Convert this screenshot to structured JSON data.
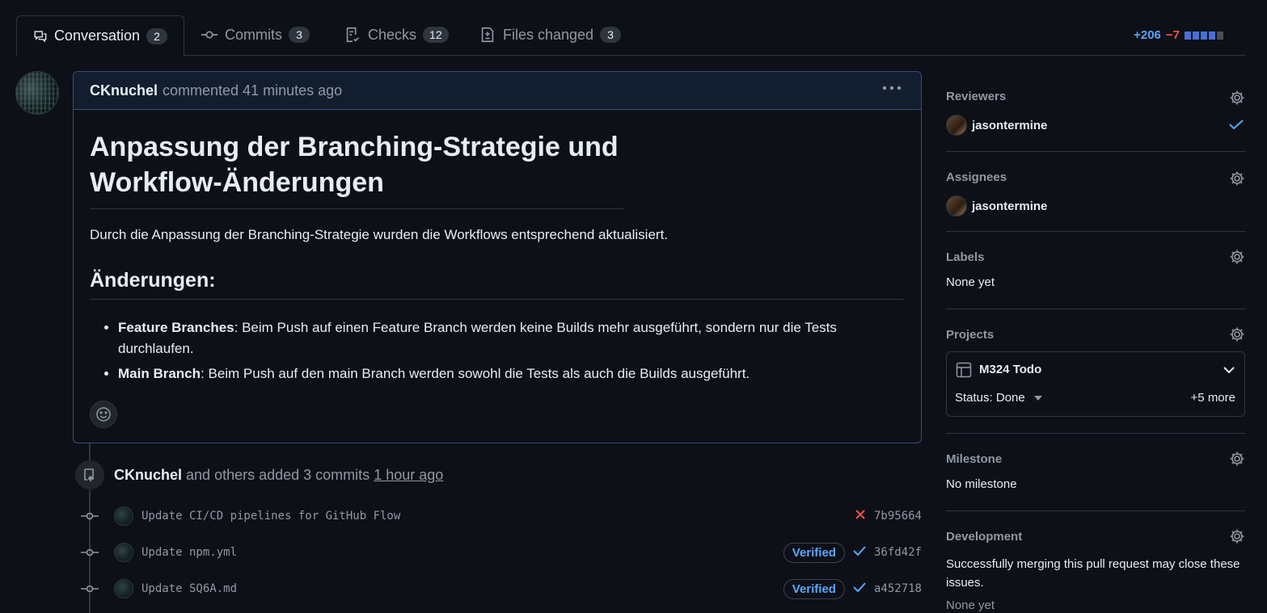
{
  "tabs": [
    {
      "label": "Conversation",
      "count": "2",
      "icon": "comment-discussion-icon",
      "active": true
    },
    {
      "label": "Commits",
      "count": "3",
      "icon": "git-commit-icon",
      "active": false
    },
    {
      "label": "Checks",
      "count": "12",
      "icon": "checklist-icon",
      "active": false
    },
    {
      "label": "Files changed",
      "count": "3",
      "icon": "file-diff-icon",
      "active": false
    }
  ],
  "diffstat": {
    "additions": "+206",
    "deletions": "−7",
    "blocks_filled_fraction": 0.8
  },
  "comment": {
    "author": "CKnuchel",
    "meta": "commented 41 minutes ago",
    "title": "Anpassung der Branching-Strategie und Workflow-Änderungen",
    "intro": "Durch die Anpassung der Branching-Strategie wurden die Workflows entsprechend aktualisiert.",
    "changes_heading": "Änderungen:",
    "items": [
      {
        "strong": "Feature Branches",
        "text": ": Beim Push auf einen Feature Branch werden keine Builds mehr ausgeführt, sondern nur die Tests durchlaufen."
      },
      {
        "strong": "Main Branch",
        "text": ": Beim Push auf den main Branch werden sowohl die Tests als auch die Builds ausgeführt."
      }
    ]
  },
  "push_event": {
    "author": "CKnuchel",
    "text": "and others added 3 commits",
    "time": "1 hour ago"
  },
  "commits": [
    {
      "message": "Update CI/CD pipelines for GitHub Flow",
      "verified": "",
      "status": "failure",
      "sha": "7b95664"
    },
    {
      "message": "Update npm.yml",
      "verified": "Verified",
      "status": "success",
      "sha": "36fd42f"
    },
    {
      "message": "Update SQ6A.md",
      "verified": "Verified",
      "status": "success",
      "sha": "a452718"
    }
  ],
  "sidebar": {
    "reviewers": {
      "title": "Reviewers",
      "user": "jasontermine"
    },
    "assignees": {
      "title": "Assignees",
      "user": "jasontermine"
    },
    "labels": {
      "title": "Labels",
      "value": "None yet"
    },
    "projects": {
      "title": "Projects",
      "project_name": "M324 Todo",
      "status": "Status: Done",
      "more": "+5 more"
    },
    "milestone": {
      "title": "Milestone",
      "value": "No milestone"
    },
    "development": {
      "title": "Development",
      "value": "Successfully merging this pull request may close these issues.",
      "sub": "None yet"
    }
  },
  "colors": {
    "background": "#0d1117",
    "accent": "#58a6ff",
    "failure": "#f85149",
    "border": "#30363d"
  }
}
